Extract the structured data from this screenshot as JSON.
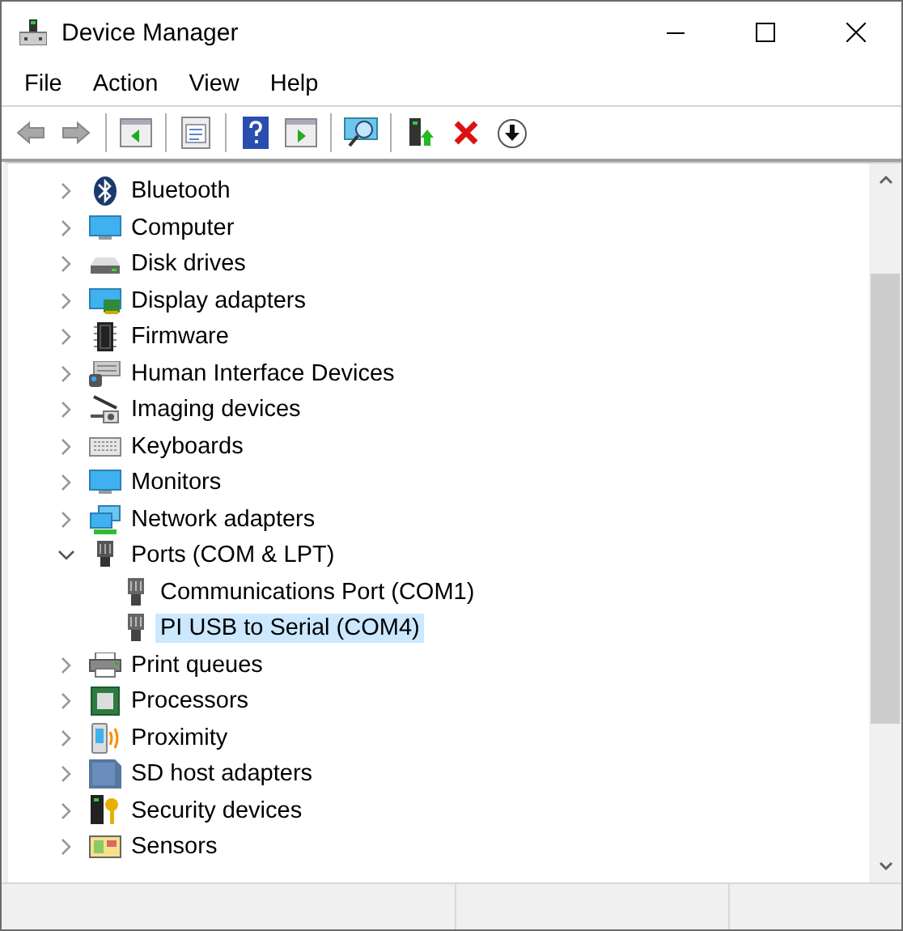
{
  "window": {
    "title": "Device Manager"
  },
  "menu": [
    {
      "label": "File"
    },
    {
      "label": "Action"
    },
    {
      "label": "View"
    },
    {
      "label": "Help"
    }
  ],
  "tree": [
    {
      "label": "Bluetooth",
      "expanded": false,
      "selected": false
    },
    {
      "label": "Computer",
      "expanded": false,
      "selected": false
    },
    {
      "label": "Disk drives",
      "expanded": false,
      "selected": false
    },
    {
      "label": "Display adapters",
      "expanded": false,
      "selected": false
    },
    {
      "label": "Firmware",
      "expanded": false,
      "selected": false
    },
    {
      "label": "Human Interface Devices",
      "expanded": false,
      "selected": false
    },
    {
      "label": "Imaging devices",
      "expanded": false,
      "selected": false
    },
    {
      "label": "Keyboards",
      "expanded": false,
      "selected": false
    },
    {
      "label": "Monitors",
      "expanded": false,
      "selected": false
    },
    {
      "label": "Network adapters",
      "expanded": false,
      "selected": false
    },
    {
      "label": "Ports (COM & LPT)",
      "expanded": true,
      "selected": false,
      "children": [
        {
          "label": "Communications Port (COM1)",
          "selected": false
        },
        {
          "label": "PI USB to Serial (COM4)",
          "selected": true
        }
      ]
    },
    {
      "label": "Print queues",
      "expanded": false,
      "selected": false
    },
    {
      "label": "Processors",
      "expanded": false,
      "selected": false
    },
    {
      "label": "Proximity",
      "expanded": false,
      "selected": false
    },
    {
      "label": "SD host adapters",
      "expanded": false,
      "selected": false
    },
    {
      "label": "Security devices",
      "expanded": false,
      "selected": false
    },
    {
      "label": "Sensors",
      "expanded": false,
      "selected": false
    }
  ]
}
